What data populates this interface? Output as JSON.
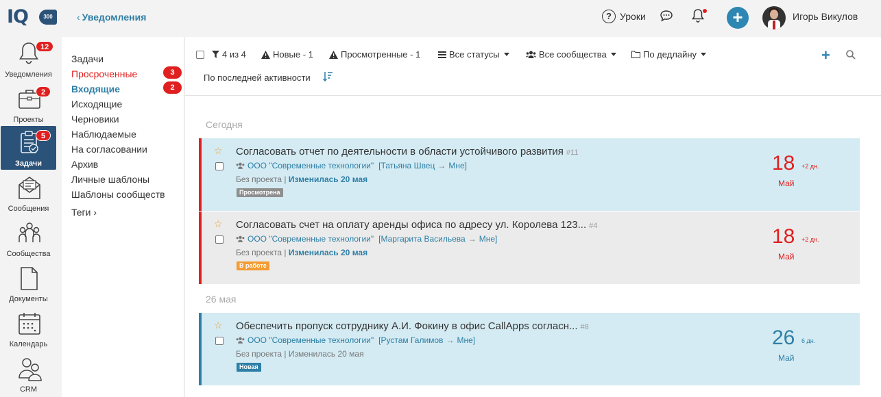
{
  "header": {
    "logo_text": "IQ",
    "logo_badge": "300",
    "back_label": "Уведомления",
    "lessons_label": "Уроки",
    "user_name": "Игорь Викулов"
  },
  "leftnav": [
    {
      "label": "Уведомления",
      "badge": "12",
      "icon": "bell-icon"
    },
    {
      "label": "Проекты",
      "badge": "2",
      "icon": "briefcase-icon"
    },
    {
      "label": "Задачи",
      "badge": "5",
      "icon": "clipboard-check-icon",
      "active": true
    },
    {
      "label": "Сообщения",
      "badge": "",
      "icon": "envelope-icon"
    },
    {
      "label": "Сообщества",
      "badge": "",
      "icon": "people-icon"
    },
    {
      "label": "Документы",
      "badge": "",
      "icon": "document-icon"
    },
    {
      "label": "Календарь",
      "badge": "",
      "icon": "calendar-icon"
    },
    {
      "label": "CRM",
      "badge": "",
      "icon": "crm-icon"
    }
  ],
  "submenu": {
    "items": [
      "Задачи",
      "Просроченные",
      "Входящие",
      "Исходящие",
      "Черновики",
      "Наблюдаемые",
      "На согласовании",
      "Архив",
      "Личные шаблоны",
      "Шаблоны сообществ",
      "Теги"
    ],
    "badges": {
      "overdue": "3",
      "incoming": "2"
    }
  },
  "filters": {
    "count": "4 из 4",
    "new": "Новые - 1",
    "viewed": "Просмотренные - 1",
    "statuses": "Все статусы",
    "communities": "Все сообщества",
    "deadline": "По дедлайну",
    "sort": "По последней активности"
  },
  "groups": [
    "Сегодня",
    "26 мая"
  ],
  "tasks": [
    {
      "title": "Согласовать отчет по деятельности в области устойчивого развития",
      "num": "#11",
      "community": "ООО \"Современные технологии\"",
      "from": "Татьяна Швец",
      "to": "Мне",
      "project": "Без проекта",
      "changed": "Изменилась 20 мая",
      "status": "Просмотрена",
      "status_color": "#8f8f8f",
      "due_day": "18",
      "due_extra": "+2 дн.",
      "due_month": "Май"
    },
    {
      "title": "Согласовать счет на оплату аренды офиса по адресу ул. Королева 123...",
      "num": "#4",
      "community": "ООО \"Современные технологии\"",
      "from": "Маргарита Васильева",
      "to": "Мне",
      "project": "Без проекта",
      "changed": "Изменилась 20 мая",
      "status": "В работе",
      "status_color": "#f39c34",
      "due_day": "18",
      "due_extra": "+2 дн.",
      "due_month": "Май"
    },
    {
      "title": "Обеспечить пропуск сотруднику А.И. Фокину в офис CallApps согласн...",
      "num": "#8",
      "community": "ООО \"Современные технологии\"",
      "from": "Рустам Галимов",
      "to": "Мне",
      "project": "Без проекта",
      "changed": "Изменилась 20 мая",
      "status": "Новая",
      "status_color": "#2e7fa6",
      "due_day": "26",
      "due_extra": "6 дн.",
      "due_month": "Май"
    }
  ],
  "colors": {
    "accent": "#2e7fa6",
    "brand": "#2b5278",
    "danger": "#e02020"
  }
}
